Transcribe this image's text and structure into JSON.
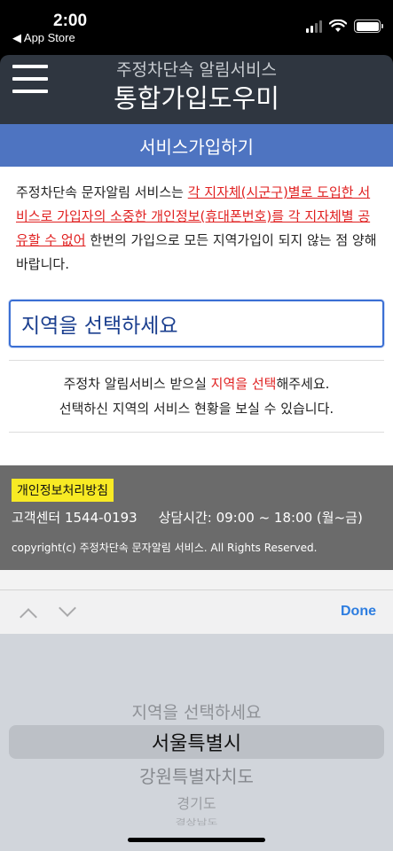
{
  "status_bar": {
    "time": "2:00",
    "back_label": "◀ App Store"
  },
  "header": {
    "subtitle": "주정차단속 알림서비스",
    "title": "통합가입도우미"
  },
  "section": {
    "title": "서비스가입하기"
  },
  "notice": {
    "part1": "주정차단속 문자알림 서비스는 ",
    "highlight": "각 지자체(시군구)별로 도입한 서비스로 가입자의 소중한 개인정보(휴대폰번호)를 각 지자체별 공유할 수 없어",
    "part2": " 한번의 가입으로 모든 지역가입이 되지 않는 점 양해바랍니다."
  },
  "region_select": {
    "placeholder": "지역을 선택하세요"
  },
  "hint": {
    "line1_pre": "주정차 알림서비스 받으실 ",
    "line1_highlight": "지역을 선택",
    "line1_post": "해주세요.",
    "line2": "선택하신 지역의 서비스 현황을 보실 수 있습니다."
  },
  "footer": {
    "privacy_label": "개인정보처리방침",
    "customer_center": "고객센터 1544-0193",
    "hours": "상담시간: 09:00 ~ 18:00 (월~금)",
    "copyright": "copyright(c) 주정차단속 문자알림 서비스. All Rights Reserved."
  },
  "toolbar": {
    "done_label": "Done"
  },
  "picker": {
    "options": [
      "지역을 선택하세요",
      "서울특별시",
      "강원특별자치도",
      "경기도",
      "경상남도"
    ],
    "selected": "서울특별시"
  },
  "colors": {
    "header_bg": "#2f3640",
    "section_bar": "#4e74c1",
    "highlight_red": "#e02020",
    "footer_bg": "#6b6b6b",
    "badge_yellow": "#f8ea24",
    "done_blue": "#2d7de0"
  }
}
